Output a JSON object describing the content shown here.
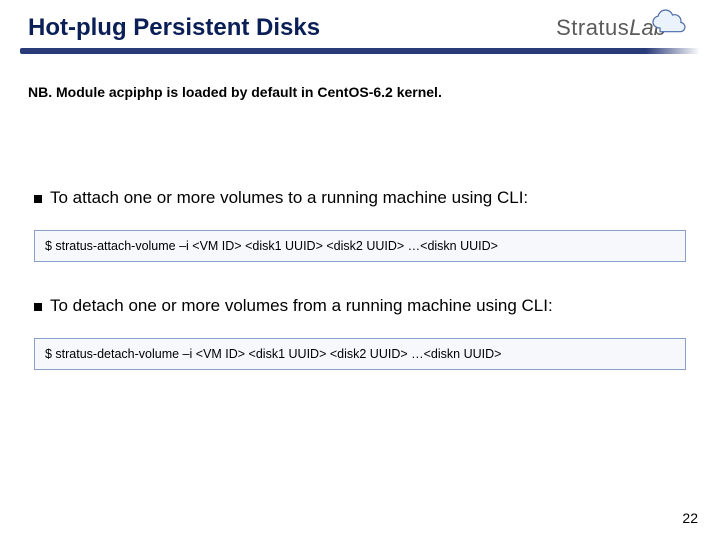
{
  "header": {
    "title": "Hot-plug Persistent Disks",
    "logo": {
      "stratus": "Stratus",
      "lab": "Lab"
    }
  },
  "content": {
    "note": "NB. Module acpiphp is loaded by default in CentOS-6.2 kernel.",
    "bullets": [
      "To attach   one or more volumes to a running machine using CLI:",
      "To detach one or more volumes from a running machine using CLI:"
    ],
    "code": [
      "$ stratus-attach-volume –i <VM ID> <disk1 UUID> <disk2 UUID> …<diskn UUID>",
      "$ stratus-detach-volume –i <VM ID> <disk1 UUID> <disk2 UUID> …<diskn UUID>"
    ]
  },
  "page_number": "22"
}
